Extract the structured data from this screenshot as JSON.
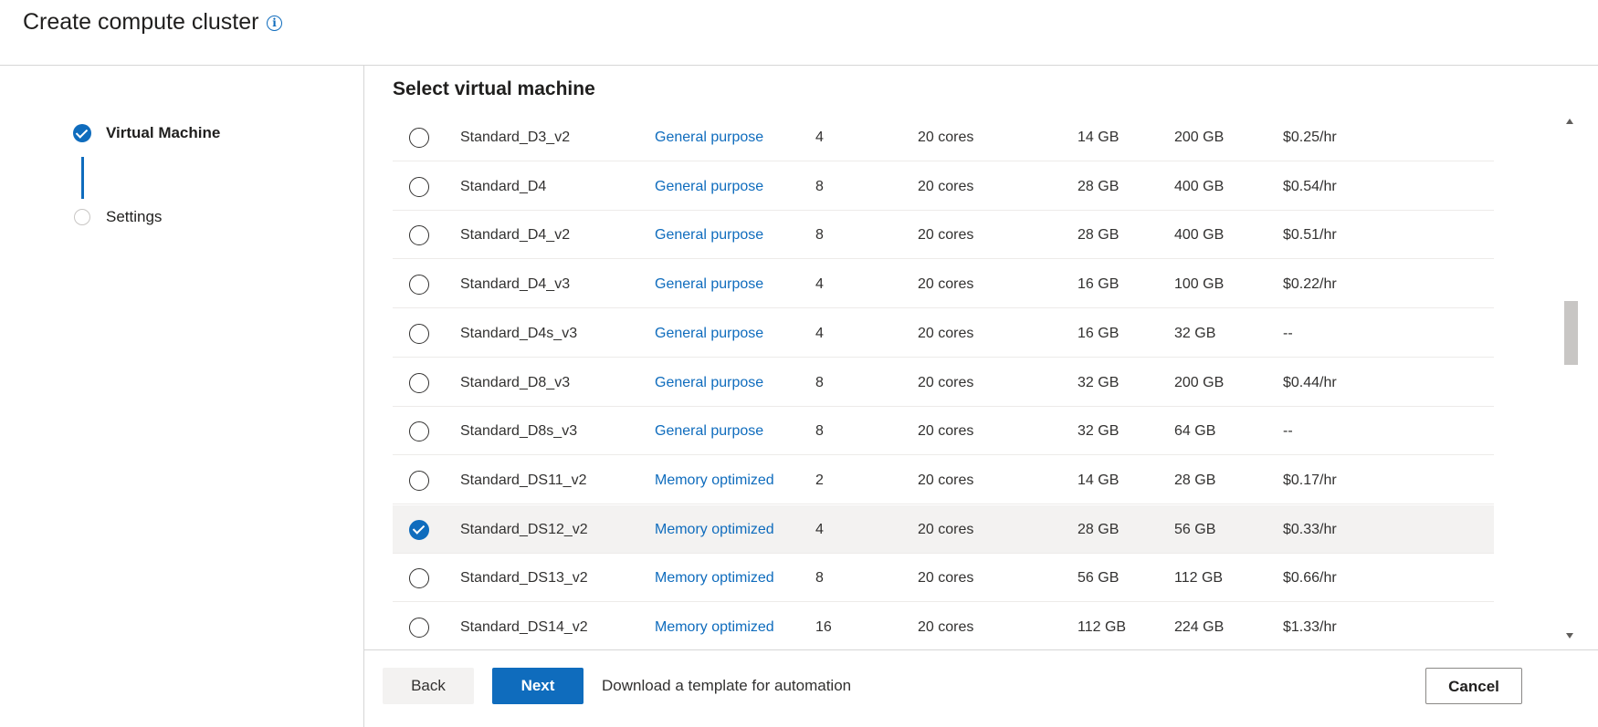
{
  "header": {
    "title": "Create compute cluster",
    "info_icon": "info-icon"
  },
  "steps": [
    {
      "label": "Virtual Machine",
      "state": "completed"
    },
    {
      "label": "Settings",
      "state": "pending"
    }
  ],
  "main": {
    "section_title": "Select virtual machine",
    "rows": [
      {
        "name": "Standard_D3_v2",
        "category": "General purpose",
        "cpus": "4",
        "quota": "20 cores",
        "ram": "14 GB",
        "storage": "200 GB",
        "cost": "$0.25/hr",
        "selected": false
      },
      {
        "name": "Standard_D4",
        "category": "General purpose",
        "cpus": "8",
        "quota": "20 cores",
        "ram": "28 GB",
        "storage": "400 GB",
        "cost": "$0.54/hr",
        "selected": false
      },
      {
        "name": "Standard_D4_v2",
        "category": "General purpose",
        "cpus": "8",
        "quota": "20 cores",
        "ram": "28 GB",
        "storage": "400 GB",
        "cost": "$0.51/hr",
        "selected": false
      },
      {
        "name": "Standard_D4_v3",
        "category": "General purpose",
        "cpus": "4",
        "quota": "20 cores",
        "ram": "16 GB",
        "storage": "100 GB",
        "cost": "$0.22/hr",
        "selected": false
      },
      {
        "name": "Standard_D4s_v3",
        "category": "General purpose",
        "cpus": "4",
        "quota": "20 cores",
        "ram": "16 GB",
        "storage": "32 GB",
        "cost": "--",
        "selected": false
      },
      {
        "name": "Standard_D8_v3",
        "category": "General purpose",
        "cpus": "8",
        "quota": "20 cores",
        "ram": "32 GB",
        "storage": "200 GB",
        "cost": "$0.44/hr",
        "selected": false
      },
      {
        "name": "Standard_D8s_v3",
        "category": "General purpose",
        "cpus": "8",
        "quota": "20 cores",
        "ram": "32 GB",
        "storage": "64 GB",
        "cost": "--",
        "selected": false
      },
      {
        "name": "Standard_DS11_v2",
        "category": "Memory optimized",
        "cpus": "2",
        "quota": "20 cores",
        "ram": "14 GB",
        "storage": "28 GB",
        "cost": "$0.17/hr",
        "selected": false
      },
      {
        "name": "Standard_DS12_v2",
        "category": "Memory optimized",
        "cpus": "4",
        "quota": "20 cores",
        "ram": "28 GB",
        "storage": "56 GB",
        "cost": "$0.33/hr",
        "selected": true
      },
      {
        "name": "Standard_DS13_v2",
        "category": "Memory optimized",
        "cpus": "8",
        "quota": "20 cores",
        "ram": "56 GB",
        "storage": "112 GB",
        "cost": "$0.66/hr",
        "selected": false
      },
      {
        "name": "Standard_DS14_v2",
        "category": "Memory optimized",
        "cpus": "16",
        "quota": "20 cores",
        "ram": "112 GB",
        "storage": "224 GB",
        "cost": "$1.33/hr",
        "selected": false
      }
    ]
  },
  "footer": {
    "back_label": "Back",
    "next_label": "Next",
    "download_label": "Download a template for automation",
    "cancel_label": "Cancel"
  },
  "colors": {
    "accent": "#0f6cbd",
    "selected_row": "#f3f2f1"
  }
}
